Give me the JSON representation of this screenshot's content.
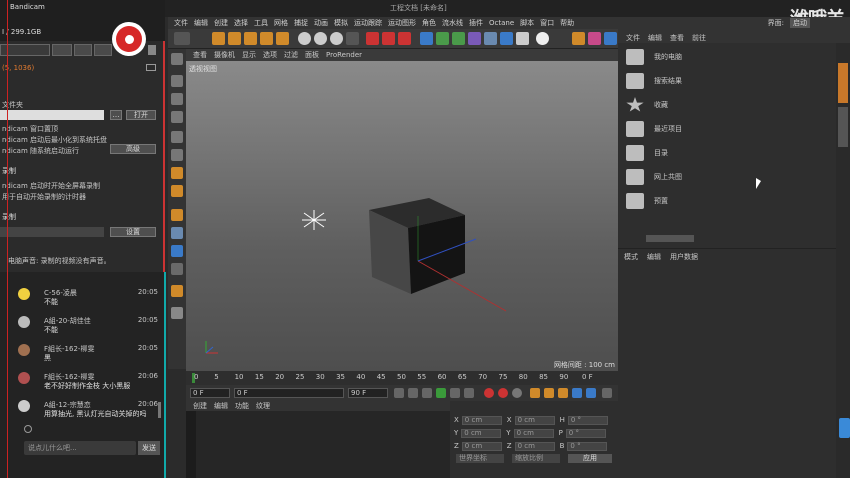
{
  "recorder": {
    "title": "Bandicam",
    "disk": "I / 299.1GB",
    "resolution": "(5, 1036)",
    "folder_label": "文件夹",
    "open_button": "打开",
    "options": [
      "ndicam 窗口置顶",
      "ndicam 启动后最小化到系统托盘",
      "ndicam 随系统启动运行"
    ],
    "advanced_button": "高级",
    "auto_section": "录制",
    "auto_options": [
      "ndicam 启动时开始全屏幕录制",
      "用于自动开始录制的计时器"
    ],
    "auto_end_section": "录制",
    "settings_button": "设置",
    "status": "电脑声音: 录制的视频没有声音。"
  },
  "chat": {
    "messages": [
      {
        "name": "C-56-凌晨",
        "time": "20:05",
        "text": "不能",
        "color": "#f0d040"
      },
      {
        "name": "A組-20-胡佳佳",
        "time": "20:05",
        "text": "不能",
        "color": "#bbbbbb"
      },
      {
        "name": "F組长-162-柳雯",
        "time": "20:05",
        "text": "黑",
        "color": "#a07050"
      },
      {
        "name": "F組长-162-柳雯",
        "time": "20:06",
        "text": "老不好好制作金枝 大小黑服",
        "color": "#b05050"
      },
      {
        "name": "A組-12-宗慧恋",
        "time": "20:06",
        "text": "用算抽光, 黑认灯光自动关掉的吗",
        "color": "#cccccc"
      }
    ],
    "input_placeholder": "说点儿什么吧...",
    "send_button": "发送"
  },
  "c4d": {
    "window_title": "工程文档 [未命名]",
    "menu": [
      "文件",
      "编辑",
      "创建",
      "选择",
      "工具",
      "网格",
      "捕捉",
      "动画",
      "模拟",
      "运动跟踪",
      "运动图形",
      "角色",
      "流水线",
      "插件",
      "Octane",
      "脚本",
      "窗口",
      "帮助"
    ],
    "layout_label": "界面:",
    "layout_value": "启动",
    "viewport_menu": [
      "查看",
      "摄像机",
      "显示",
      "选项",
      "过滤",
      "面板",
      "ProRender"
    ],
    "viewport_label": "透视视图",
    "grid_spacing": "网格间距 : 100 cm",
    "timeline_ticks": [
      "0",
      "5",
      "10",
      "15",
      "20",
      "25",
      "30",
      "35",
      "40",
      "45",
      "50",
      "55",
      "60",
      "65",
      "70",
      "75",
      "80",
      "85",
      "90"
    ],
    "frame_display": "0 F",
    "start_frame": "0 F",
    "current_frame": "0 F",
    "end_frame": "90 F",
    "end_frame2": "90 F",
    "material_menu": [
      "创建",
      "编辑",
      "功能",
      "纹理"
    ],
    "coords": {
      "rows": [
        {
          "a": "X",
          "av": "0 cm",
          "b": "X",
          "bv": "0 cm",
          "c": "H",
          "cv": "0 °"
        },
        {
          "a": "Y",
          "av": "0 cm",
          "b": "Y",
          "bv": "0 cm",
          "c": "P",
          "cv": "0 °"
        },
        {
          "a": "Z",
          "av": "0 cm",
          "b": "Z",
          "bv": "0 cm",
          "c": "B",
          "cv": "0 °"
        }
      ],
      "mode1": "世界坐标",
      "mode2": "缩放比例",
      "apply": "应用"
    },
    "browser_tabs": [
      "文件",
      "编辑",
      "查看",
      "前往"
    ],
    "browser_items": [
      "我的电脑",
      "搜索结果",
      "收藏",
      "最近项目",
      "目录",
      "网上共图",
      "预置"
    ],
    "attr_tabs": [
      "模式",
      "编辑",
      "用户数据"
    ],
    "watermark": "潍哦羊"
  }
}
